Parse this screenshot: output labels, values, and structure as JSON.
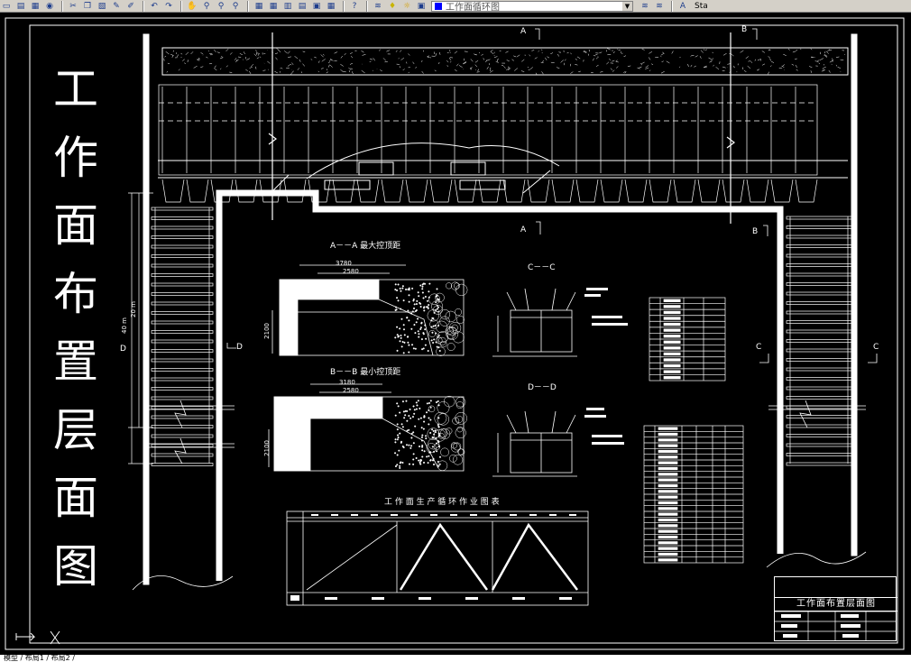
{
  "toolbar": {
    "layer_name": "工作面循环图",
    "style_label": "Sta",
    "layer_color": "#0000ff",
    "buttons": [
      "open-icon",
      "save-icon",
      "plot-icon",
      "preview-icon",
      "cut-icon",
      "copy-icon",
      "paste-icon",
      "matchprop-icon",
      "brush-icon",
      "undo-icon",
      "redo-icon",
      "pan-icon",
      "zoom-realtime-icon",
      "zoom-window-icon",
      "zoom-previous-icon",
      "properties-icon",
      "designcenter-icon",
      "toolpalette-icon",
      "sheetset-icon",
      "markup-icon",
      "calculator-icon",
      "help-icon",
      "layer-manager-icon",
      "lightbulb-icon",
      "sun-icon",
      "lock-icon",
      "color-icon"
    ]
  },
  "drawing": {
    "main_title_chars": [
      "工",
      "作",
      "面",
      "布",
      "置",
      "层",
      "面",
      "图"
    ],
    "section_labels": {
      "a_top": "A",
      "b_top": "B",
      "a_bottom": "A",
      "b_bottom": "B",
      "c_left": "C",
      "c_right": "C",
      "d_left": "D"
    },
    "section_aa": {
      "title": "A－－A 最大控顶距",
      "dim_outer": "3780",
      "dim_inner": "2580",
      "dim_height": "2100"
    },
    "section_bb": {
      "title": "B－－B 最小控顶距",
      "dim_outer": "3180",
      "dim_inner": "2580",
      "dim_height": "2100"
    },
    "section_cc": {
      "title": "C－－C"
    },
    "section_dd": {
      "title": "D－－D"
    },
    "dim_left": {
      "d_label": "D",
      "len_40": "40 m",
      "len_20": "20 m"
    },
    "cycle_chart_title": "工 作 面 生 产 循 环 作 业 图 表",
    "title_block": {
      "title": "工作面布置层面图"
    }
  },
  "statusbar": {
    "tabs": "模型 / 布局1 / 布局2 /"
  }
}
